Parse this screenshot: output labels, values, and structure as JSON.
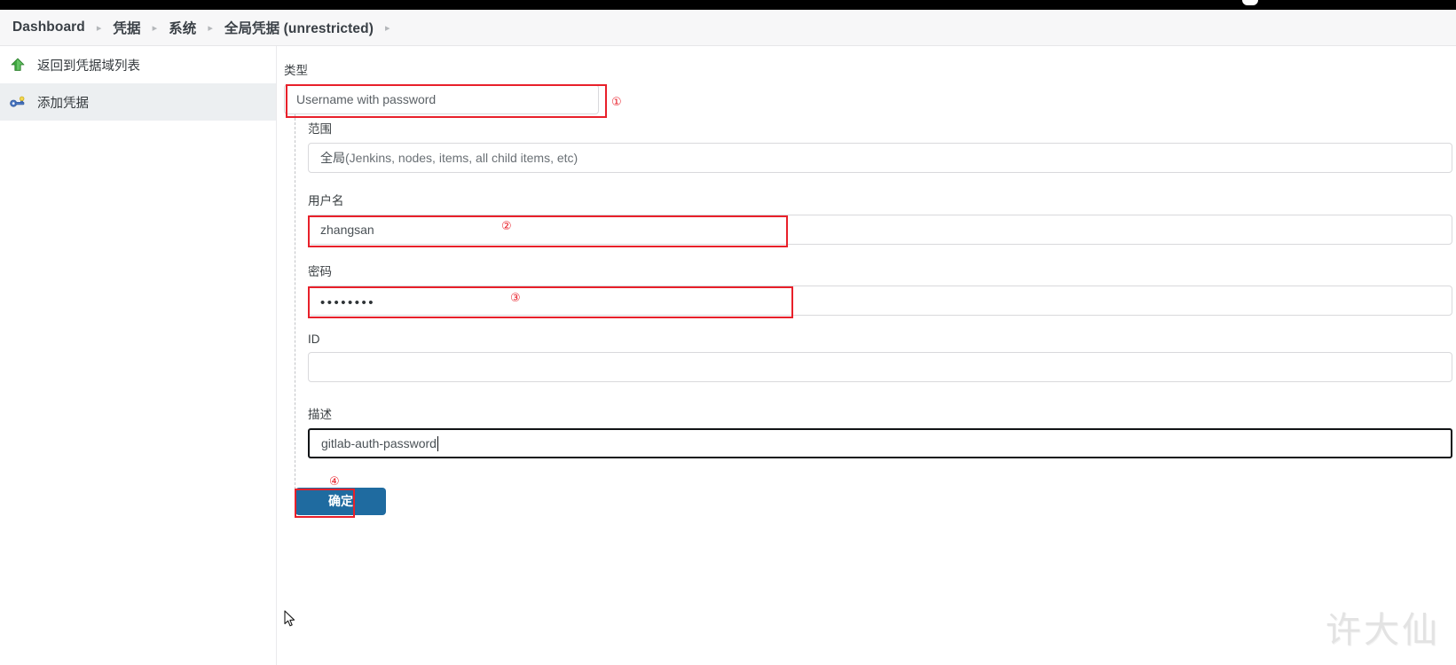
{
  "browser": {
    "tab_strip_color": "#000000"
  },
  "breadcrumb": {
    "separator": "▸",
    "items": [
      {
        "label": "Dashboard"
      },
      {
        "label": "凭据"
      },
      {
        "label": "系统"
      },
      {
        "label": "全局凭据 (unrestricted)"
      }
    ]
  },
  "sidebar": {
    "items": [
      {
        "label": "返回到凭据域列表",
        "icon": "up-arrow-icon",
        "selected": false
      },
      {
        "label": "添加凭据",
        "icon": "key-icon",
        "selected": true
      }
    ]
  },
  "form": {
    "type": {
      "label": "类型",
      "value": "Username with password"
    },
    "scope": {
      "label": "范围",
      "value_main": "全局",
      "value_sub": " (Jenkins, nodes, items, all child items, etc)"
    },
    "username": {
      "label": "用户名",
      "value": "zhangsan"
    },
    "password": {
      "label": "密码",
      "value": "••••••••"
    },
    "id": {
      "label": "ID",
      "value": ""
    },
    "description": {
      "label": "描述",
      "value": "gitlab-auth-password"
    },
    "submit": {
      "label": "确定"
    }
  },
  "annotations": {
    "color": "#e8202a",
    "markers": [
      {
        "number": "①",
        "target": "type-field"
      },
      {
        "number": "②",
        "target": "username-field"
      },
      {
        "number": "③",
        "target": "password-field"
      },
      {
        "number": "④",
        "target": "submit-button"
      }
    ]
  },
  "watermark": {
    "text": "许大仙"
  }
}
